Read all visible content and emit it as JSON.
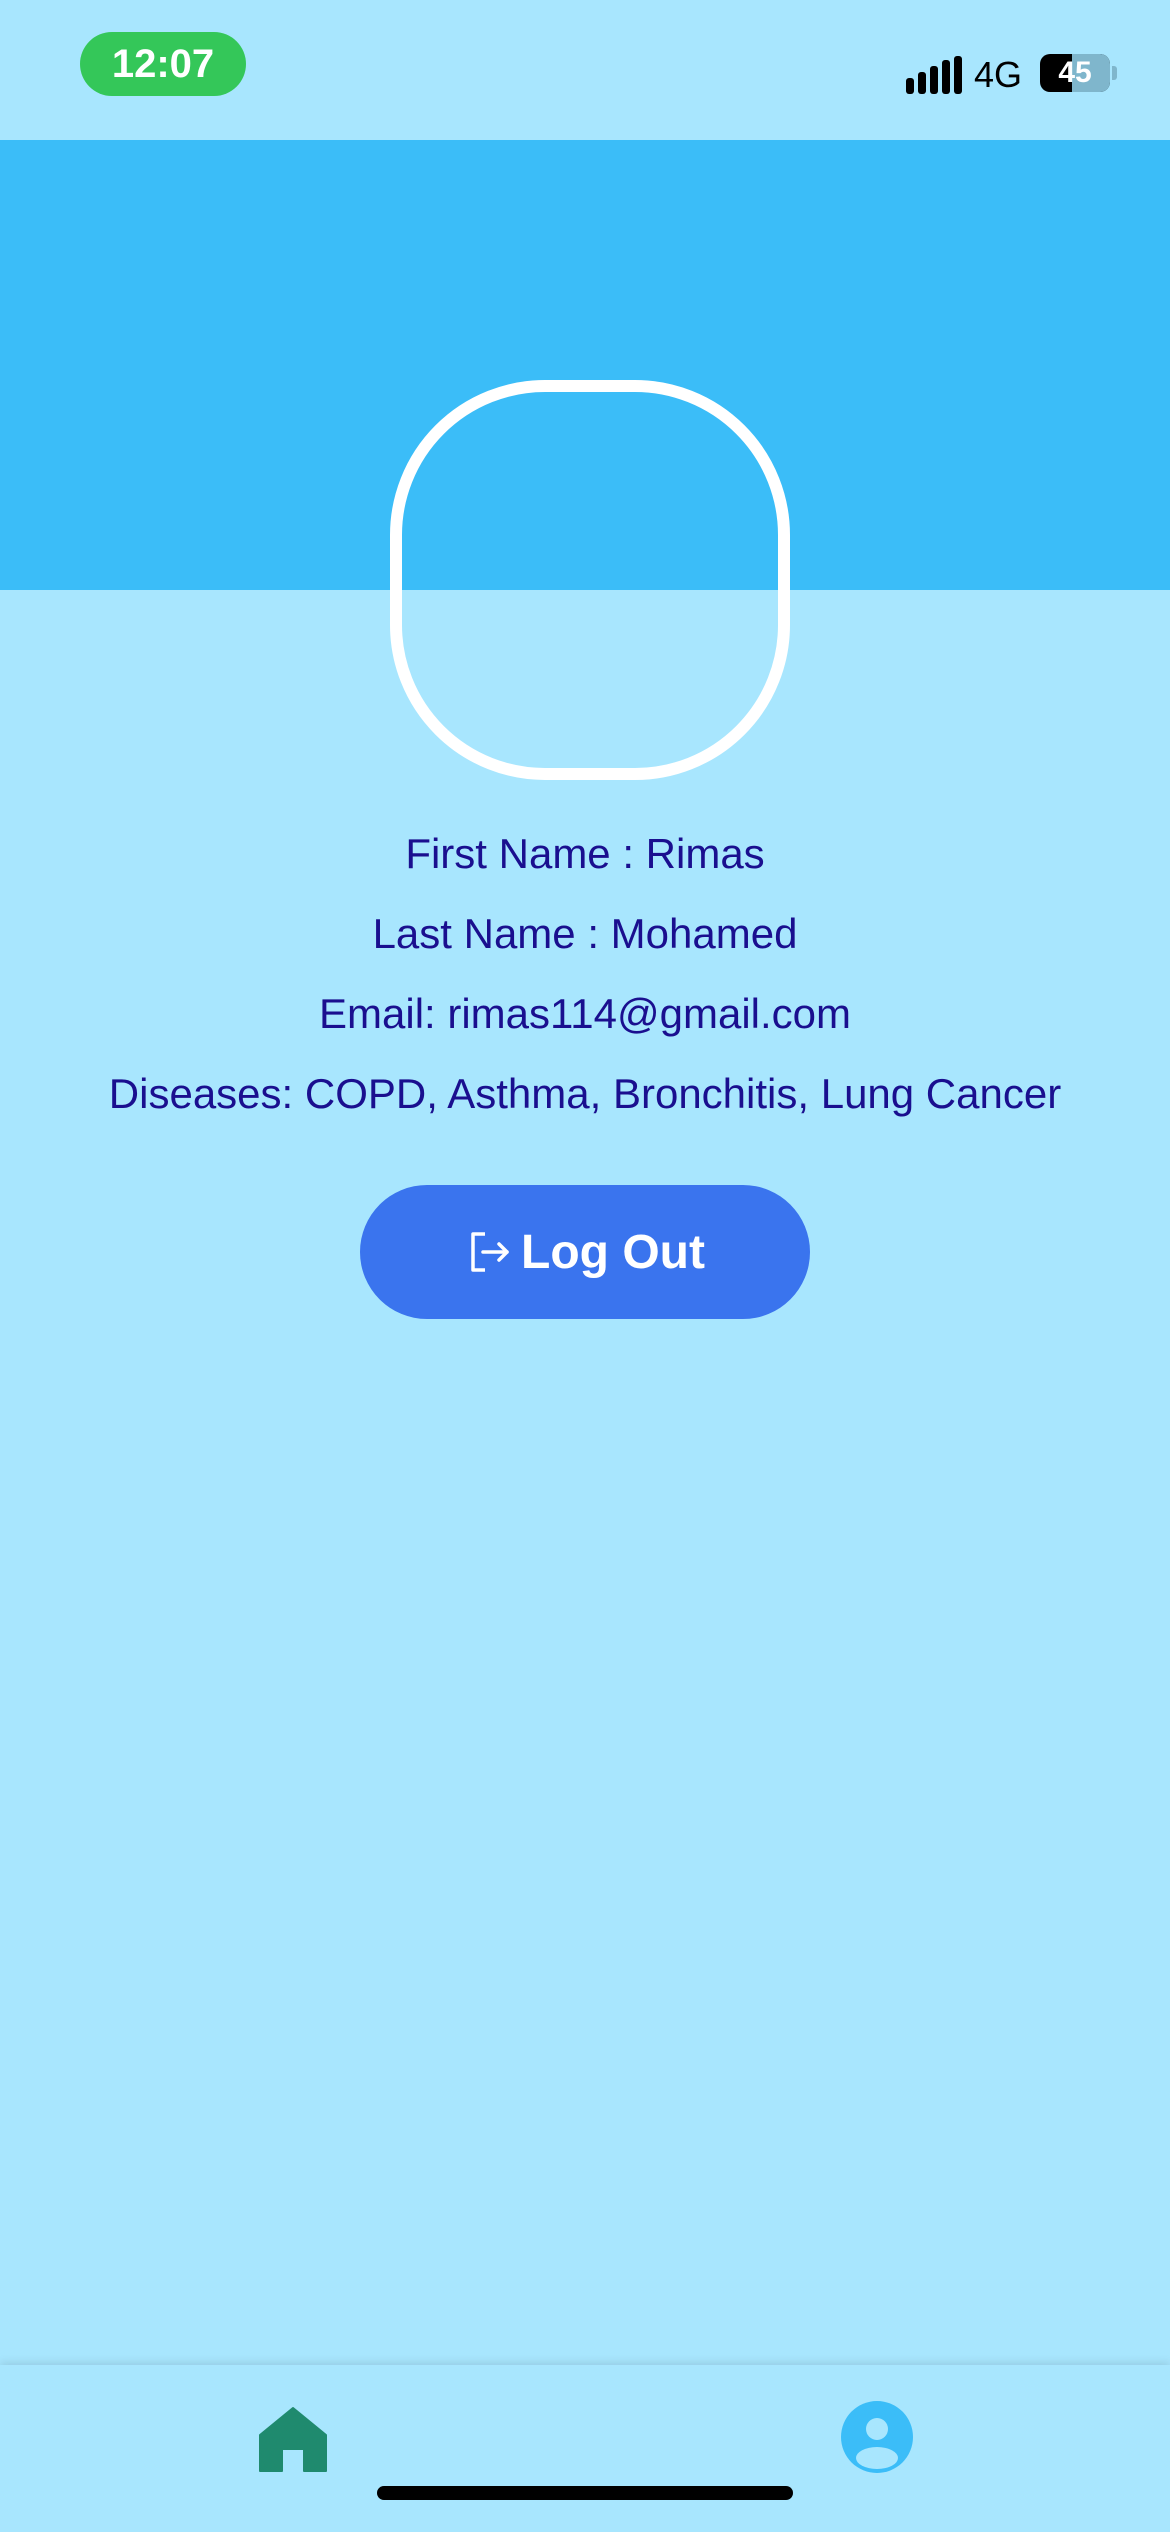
{
  "status_bar": {
    "time": "12:07",
    "network": "4G",
    "battery": "45"
  },
  "profile": {
    "first_name": "First Name : Rimas",
    "last_name": "Last Name : Mohamed",
    "email": "Email: rimas114@gmail.com",
    "diseases": "Diseases: COPD, Asthma, Bronchitis, Lung Cancer"
  },
  "actions": {
    "logout_label": "Log Out",
    "logout_icon": "logout-icon"
  },
  "tab_bar": {
    "items": [
      {
        "icon": "home-icon",
        "active": true
      },
      {
        "icon": "profile-icon",
        "active": false
      }
    ]
  },
  "colors": {
    "background": "#A8E6FE",
    "header": "#3BBDF8",
    "text": "#1A0F8F",
    "button": "#3A74EE",
    "home_icon": "#1F8A6E",
    "profile_icon": "#3BBDF8"
  }
}
